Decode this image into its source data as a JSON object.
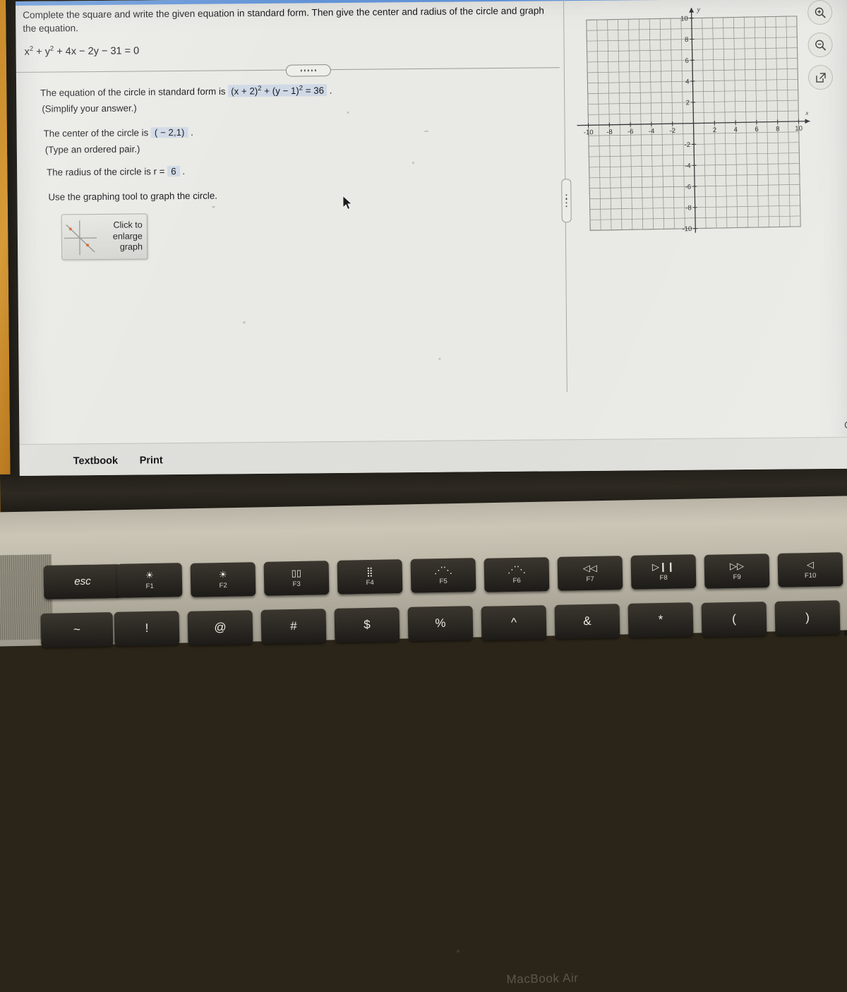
{
  "device": {
    "brand_label": "MacBook Air"
  },
  "problem": {
    "prompt": "Complete the square and write the given equation in standard form. Then give the center and radius of the circle and graph the equation.",
    "given_equation": {
      "lhs_a": "x",
      "exp_a": "2",
      "mid": " + y",
      "exp_b": "2",
      "rest": " + 4x − 2y − 31 = 0"
    },
    "steps": {
      "standard_form_label": "The equation of the circle in standard form is",
      "standard_form_answer_a": "(x + 2)",
      "standard_form_exp_a": "2",
      "standard_form_answer_b": " + (y − 1)",
      "standard_form_exp_b": "2",
      "standard_form_answer_c": " = 36",
      "standard_form_hint": "(Simplify your answer.)",
      "center_label": "The center of the circle is",
      "center_answer": "( − 2,1)",
      "center_hint": "(Type an ordered pair.)",
      "radius_label": "The radius of the circle is r =",
      "radius_answer": "6",
      "graph_instruction": "Use the graphing tool to graph the circle."
    },
    "enlarge_button_label": "Click to\nenlarge\ngraph"
  },
  "chart_data": {
    "type": "scatter",
    "title": "",
    "xlabel": "x",
    "ylabel": "y",
    "xlim": [
      -10,
      10
    ],
    "ylim": [
      -10,
      10
    ],
    "xticks": [
      -10,
      -8,
      -6,
      -4,
      -2,
      2,
      4,
      6,
      8,
      10
    ],
    "yticks": [
      -10,
      -8,
      -6,
      -4,
      -2,
      2,
      4,
      6,
      8,
      10
    ],
    "grid": true,
    "grid_step": 1,
    "series": [],
    "annotations": [],
    "note": "Empty graphing-tool coordinate plane; no circle plotted yet."
  },
  "tools": [
    {
      "name": "zoom-in-icon",
      "label": "Zoom in"
    },
    {
      "name": "zoom-out-icon",
      "label": "Zoom out"
    },
    {
      "name": "open-in-new-icon",
      "label": "Open graph in new window"
    }
  ],
  "bottom_bar": {
    "textbook_label": "Textbook",
    "print_label": "Print",
    "clear_all_truncated": "Cl"
  },
  "divider_menu": {
    "name": "more-options-dots",
    "dot_count": 5
  },
  "keyboard": {
    "function_row": [
      {
        "cap": "esc",
        "fn": ""
      },
      {
        "cap": "brightness-down-icon",
        "fn": "F1"
      },
      {
        "cap": "brightness-up-icon",
        "fn": "F2"
      },
      {
        "cap": "mission-control-icon",
        "fn": "F3"
      },
      {
        "cap": "launchpad-icon",
        "fn": "F4"
      },
      {
        "cap": "keyboard-brightness-down-icon",
        "fn": "F5"
      },
      {
        "cap": "keyboard-brightness-up-icon",
        "fn": "F6"
      },
      {
        "cap": "rewind-icon",
        "fn": "F7"
      },
      {
        "cap": "play-pause-icon",
        "fn": "F8"
      },
      {
        "cap": "fast-forward-icon",
        "fn": "F9"
      },
      {
        "cap": "mute-icon",
        "fn": "F10"
      }
    ],
    "number_row": [
      "~",
      "!",
      "@",
      "#",
      "$",
      "%",
      "^",
      "&",
      "*",
      "(",
      ")"
    ]
  },
  "colors": {
    "answer_field": "#cfd9e6",
    "page_background": "#e9e9e5",
    "bottom_bar": "#dededa",
    "accent_strip": "#3a7bd5"
  }
}
